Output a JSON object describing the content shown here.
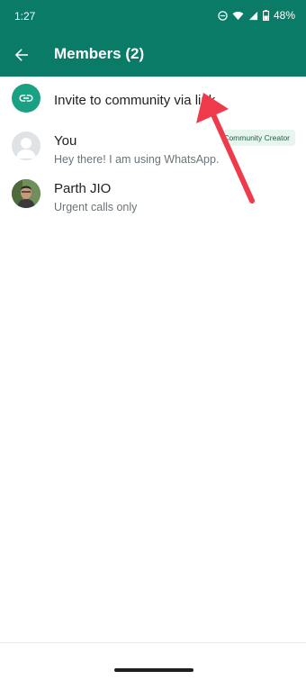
{
  "status_bar": {
    "time": "1:27",
    "battery_percent": "48%",
    "icons": [
      "do-not-disturb-icon",
      "wifi-icon",
      "signal-icon",
      "battery-icon"
    ]
  },
  "app_bar": {
    "title": "Members (2)",
    "back_icon": "arrow-left-icon"
  },
  "invite_row": {
    "label": "Invite to community via link",
    "icon": "link-icon"
  },
  "members": [
    {
      "name": "You",
      "status": "Hey there! I am using WhatsApp.",
      "badge": "Community Creator",
      "avatar": "default-avatar-icon"
    },
    {
      "name": "Parth JIO",
      "status": "Urgent calls only",
      "avatar": "profile-photo"
    }
  ],
  "colors": {
    "header": "#0a7b66",
    "accent": "#1aa184",
    "annotation_arrow": "#ee3a4a",
    "badge_bg": "#e6f6ee"
  }
}
